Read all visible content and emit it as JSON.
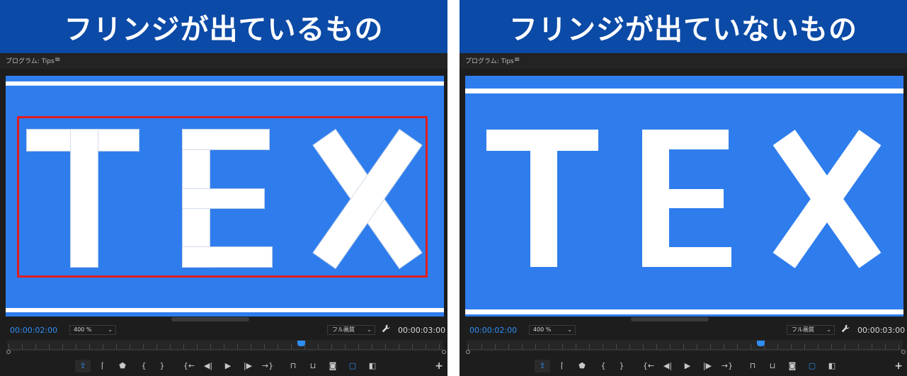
{
  "panels": [
    {
      "banner_title": "フリンジが出ているもの",
      "header_label": "プログラム: Tips",
      "menu_icon": "≡",
      "timecode_current": "00:00:02:00",
      "zoom": "400 %",
      "quality": "フル画質",
      "timecode_duration": "00:00:03:00",
      "viewer_text": [
        "T",
        "E",
        "X"
      ],
      "fringe": true,
      "highlight_frame": true
    },
    {
      "banner_title": "フリンジが出ていないもの",
      "header_label": "プログラム: Tips",
      "menu_icon": "≡",
      "timecode_current": "00:00:02:00",
      "zoom": "400 %",
      "quality": "フル画質",
      "timecode_duration": "00:00:03:00",
      "viewer_text": [
        "T",
        "E",
        "X"
      ],
      "fringe": false,
      "highlight_frame": false
    }
  ],
  "icons": {
    "caret": "⌄",
    "wrench": "wrench-icon",
    "add": "+"
  },
  "colors": {
    "banner_bg": "#0b4aa6",
    "viewer_bg": "#2f7ded",
    "accent_blue": "#2f8ff7",
    "highlight_red": "#e01e1e",
    "panel_bg": "#1d1d1d"
  },
  "transport_buttons": [
    {
      "name": "export-frame-icon",
      "glyph": "⇪"
    },
    {
      "name": "mark-in-icon",
      "glyph": "⌈"
    },
    {
      "name": "marker-icon",
      "glyph": "⬟"
    },
    {
      "name": "mark-in-brace-icon",
      "glyph": "{"
    },
    {
      "name": "mark-out-brace-icon",
      "glyph": "}"
    },
    {
      "name": "go-to-in-icon",
      "glyph": "{←"
    },
    {
      "name": "step-back-icon",
      "glyph": "◀|"
    },
    {
      "name": "play-icon",
      "glyph": "▶"
    },
    {
      "name": "step-forward-icon",
      "glyph": "|▶"
    },
    {
      "name": "go-to-out-icon",
      "glyph": "→}"
    },
    {
      "name": "lift-icon",
      "glyph": "⊓"
    },
    {
      "name": "extract-icon",
      "glyph": "⊔"
    },
    {
      "name": "camera-icon",
      "glyph": "◙"
    },
    {
      "name": "safe-margins-icon",
      "glyph": "▢"
    },
    {
      "name": "comparison-view-icon",
      "glyph": "◧"
    }
  ]
}
